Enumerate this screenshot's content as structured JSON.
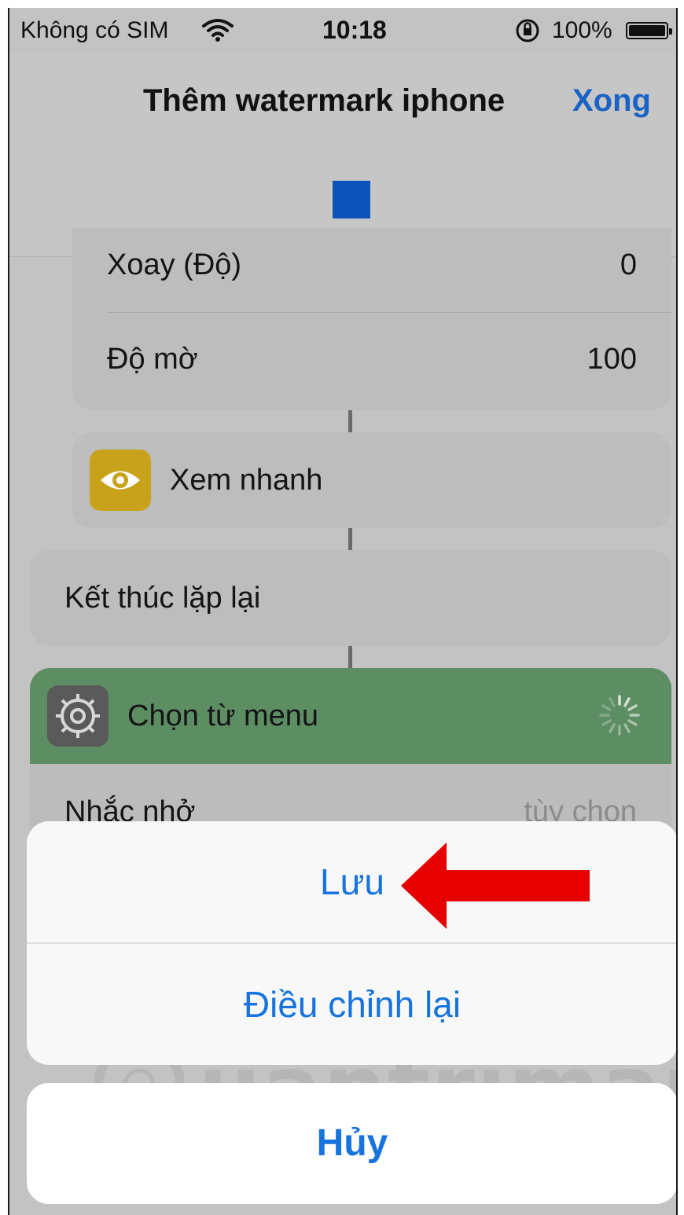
{
  "status_bar": {
    "carrier": "Không có SIM",
    "time": "10:18",
    "battery_percent": "100%",
    "wifi_icon": "wifi-icon",
    "lock_icon": "orientation-lock-icon",
    "battery_icon": "battery-icon"
  },
  "header": {
    "title": "Thêm watermark iphone",
    "done_label": "Xong",
    "stop_icon": "stop-icon"
  },
  "settings_rows": [
    {
      "label": "Xoay (Độ)",
      "value": "0"
    },
    {
      "label": "Độ mờ",
      "value": "100"
    }
  ],
  "actions": {
    "quick_look": {
      "label": "Xem nhanh",
      "icon": "eye-icon"
    },
    "end_repeat": {
      "label": "Kết thúc lặp lại"
    },
    "choose_menu": {
      "label": "Chọn từ menu",
      "icon": "gear-icon",
      "status_icon": "spinner-icon"
    },
    "prompt": {
      "label": "Nhắc nhở",
      "placeholder": "tùy chọn"
    }
  },
  "action_sheet": {
    "save_label": "Lưu",
    "adjust_label": "Điều chỉnh lại",
    "cancel_label": "Hủy"
  },
  "annotation": {
    "arrow_color": "#e60000"
  },
  "watermark": {
    "text": "uantrimang"
  },
  "colors": {
    "accent": "#1773de",
    "header_done": "#1a63c4",
    "stop_square": "#0d52b8",
    "quick_look_tile": "#c8a21a",
    "menu_header": "#5d8d63"
  }
}
